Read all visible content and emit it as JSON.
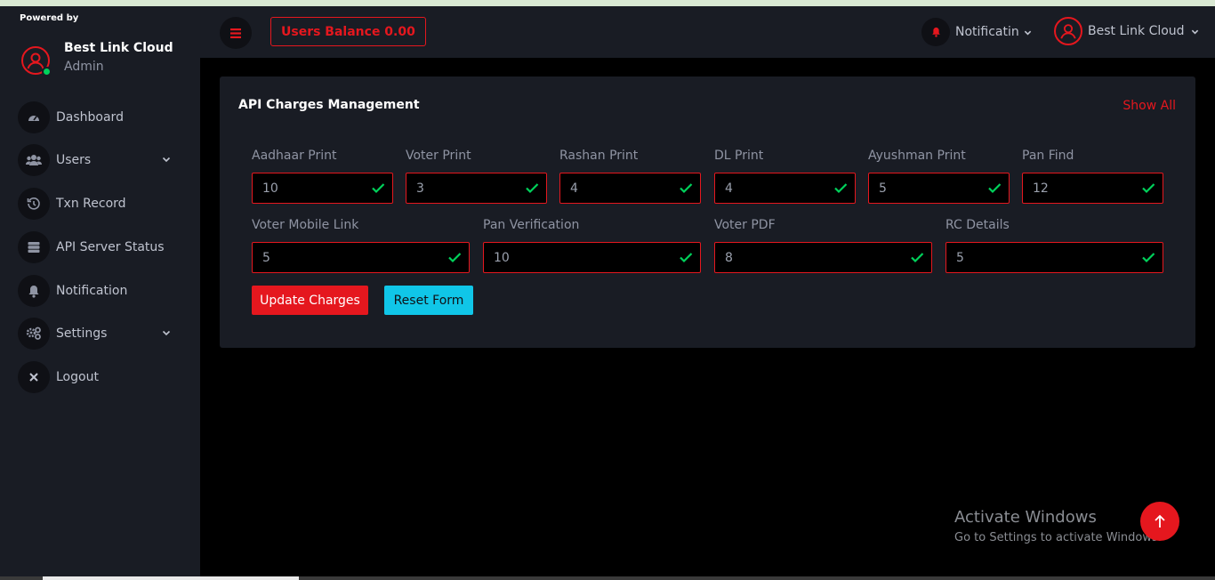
{
  "sidebar": {
    "powered_by": "Powered by",
    "profile": {
      "name": "Best Link Cloud",
      "role": "Admin"
    },
    "items": [
      {
        "label": "Dashboard",
        "icon": "speedometer-icon"
      },
      {
        "label": "Users",
        "icon": "users-icon",
        "has_submenu": true
      },
      {
        "label": "Txn Record",
        "icon": "history-icon"
      },
      {
        "label": "API Server Status",
        "icon": "server-icon"
      },
      {
        "label": "Notification",
        "icon": "bell-icon"
      },
      {
        "label": "Settings",
        "icon": "gears-icon",
        "has_submenu": true
      },
      {
        "label": "Logout",
        "icon": "close-icon"
      }
    ]
  },
  "topbar": {
    "balance_label": "Users Balance 0.00",
    "notification_label": "Notificatin",
    "user_label": "Best Link Cloud"
  },
  "card": {
    "title": "API Charges Management",
    "show_all": "Show All",
    "fields": [
      {
        "label": "Aadhaar Print",
        "value": "10"
      },
      {
        "label": "Voter Print",
        "value": "3"
      },
      {
        "label": "Rashan Print",
        "value": "4"
      },
      {
        "label": "DL Print",
        "value": "4"
      },
      {
        "label": "Ayushman Print",
        "value": "5"
      },
      {
        "label": "Pan Find",
        "value": "12"
      },
      {
        "label": "Voter Mobile Link",
        "value": "5"
      },
      {
        "label": "Pan Verification",
        "value": "10"
      },
      {
        "label": "Voter PDF",
        "value": "8"
      },
      {
        "label": "RC Details",
        "value": "5"
      }
    ],
    "update_button": "Update Charges",
    "reset_button": "Reset Form"
  },
  "watermark": {
    "title": "Activate Windows",
    "subtitle": "Go to Settings to activate Windows."
  },
  "colors": {
    "accent_red": "#e5171e",
    "accent_cyan": "#10c6e8",
    "success_green": "#00d25b",
    "sidebar_bg": "#191c24"
  }
}
